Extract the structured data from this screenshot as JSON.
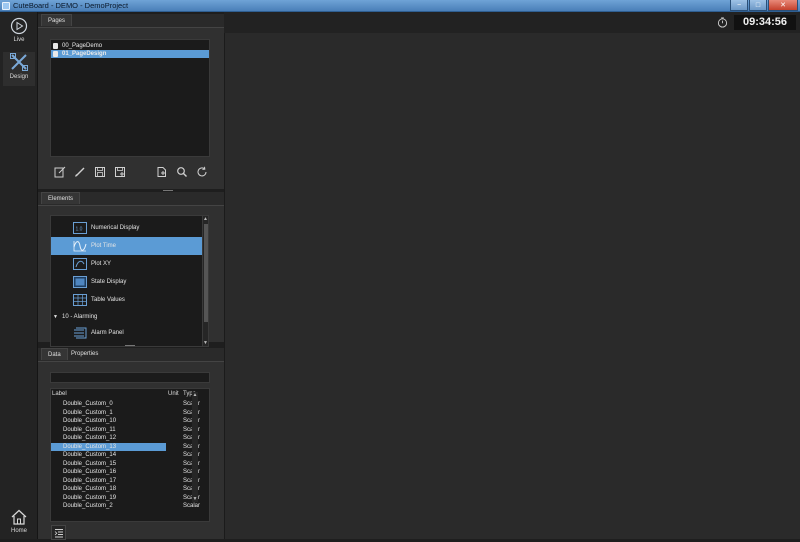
{
  "window": {
    "title": "CuteBoard - DEMO - DemoProject",
    "controls": {
      "minimize": "−",
      "maximize": "□",
      "close": "✕"
    }
  },
  "sidebar": {
    "live_label": "Live",
    "design_label": "Design",
    "home_label": "Home"
  },
  "header": {
    "clock": "09:34:56",
    "timer_icon": "timer-icon"
  },
  "pages_panel": {
    "tab_label": "Pages",
    "items": [
      {
        "label": "00_PageDemo",
        "selected": false
      },
      {
        "label": "01_PageDesign",
        "selected": true
      }
    ],
    "tools": [
      "edit-icon",
      "pencil-icon",
      "save-icon",
      "save-as-icon",
      "new-page-icon",
      "search-icon",
      "refresh-icon"
    ]
  },
  "elements_panel": {
    "tab_label": "Elements",
    "items": [
      {
        "label": "Numerical Display",
        "icon": "numerical-display-icon"
      },
      {
        "label": "Plot Time",
        "icon": "plot-time-icon",
        "selected": true
      },
      {
        "label": "Plot XY",
        "icon": "plot-xy-icon"
      },
      {
        "label": "State Display",
        "icon": "state-display-icon"
      },
      {
        "label": "Table Values",
        "icon": "table-values-icon"
      }
    ],
    "group": {
      "label": "10 - Alarming",
      "arrow": "▼"
    },
    "group_items": [
      {
        "label": "Alarm Panel",
        "icon": "alarm-panel-icon"
      }
    ],
    "scroll_up": "▲",
    "scroll_down": "▼"
  },
  "data_panel": {
    "tabs": [
      {
        "label": "Data",
        "active": true
      },
      {
        "label": "Properties",
        "active": false
      }
    ],
    "search_value": "",
    "columns": {
      "label": "Label",
      "unit": "Unit",
      "type": "Type"
    },
    "rows": [
      {
        "label": "Double_Custom_0",
        "type": "Scalar"
      },
      {
        "label": "Double_Custom_1",
        "type": "Scalar"
      },
      {
        "label": "Double_Custom_10",
        "type": "Scalar"
      },
      {
        "label": "Double_Custom_11",
        "type": "Scalar"
      },
      {
        "label": "Double_Custom_12",
        "type": "Scalar"
      },
      {
        "label": "Double_Custom_13",
        "type": "Scalar",
        "selected": true
      },
      {
        "label": "Double_Custom_14",
        "type": "Scalar"
      },
      {
        "label": "Double_Custom_15",
        "type": "Scalar"
      },
      {
        "label": "Double_Custom_16",
        "type": "Scalar"
      },
      {
        "label": "Double_Custom_17",
        "type": "Scalar"
      },
      {
        "label": "Double_Custom_18",
        "type": "Scalar"
      },
      {
        "label": "Double_Custom_19",
        "type": "Scalar"
      },
      {
        "label": "Double_Custom_2",
        "type": "Scalar"
      }
    ],
    "scroll_up": "▲",
    "scroll_down": "▼"
  },
  "colors": {
    "selection": "#5b9bd5",
    "background": "#2a2a2a",
    "titlebar": "#4a7fb8"
  }
}
